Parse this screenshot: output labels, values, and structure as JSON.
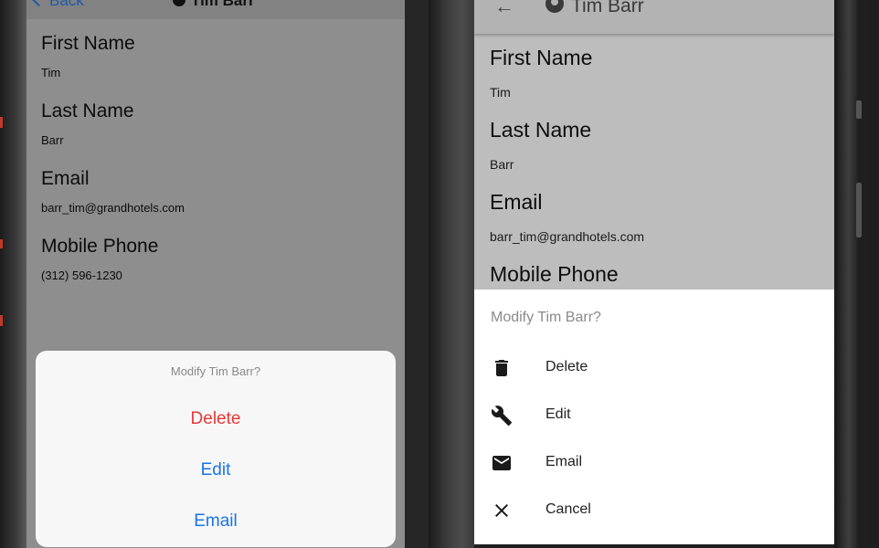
{
  "ios": {
    "back_label": "Back",
    "title": "Tim Barr",
    "fields": [
      {
        "label": "First Name",
        "value": "Tim"
      },
      {
        "label": "Last Name",
        "value": "Barr"
      },
      {
        "label": "Email",
        "value": "barr_tim@grandhotels.com"
      },
      {
        "label": "Mobile Phone",
        "value": "(312) 596-1230"
      }
    ],
    "sheet": {
      "title": "Modify Tim Barr?",
      "actions": [
        {
          "label": "Delete",
          "color": "#e53935"
        },
        {
          "label": "Edit",
          "color": "#1a73e8"
        },
        {
          "label": "Email",
          "color": "#1a73e8"
        }
      ]
    }
  },
  "android": {
    "title": "Tim Barr",
    "back_icon": "arrow-left-icon",
    "title_icon": "account-circle-icon",
    "fields": [
      {
        "label": "First Name",
        "value": "Tim"
      },
      {
        "label": "Last Name",
        "value": "Barr"
      },
      {
        "label": "Email",
        "value": "barr_tim@grandhotels.com"
      },
      {
        "label": "Mobile Phone",
        "value": ""
      }
    ],
    "sheet": {
      "title": "Modify Tim Barr?",
      "actions": [
        {
          "label": "Delete",
          "icon": "trash-icon"
        },
        {
          "label": "Edit",
          "icon": "wrench-icon"
        },
        {
          "label": "Email",
          "icon": "envelope-icon"
        },
        {
          "label": "Cancel",
          "icon": "close-icon"
        }
      ]
    }
  }
}
